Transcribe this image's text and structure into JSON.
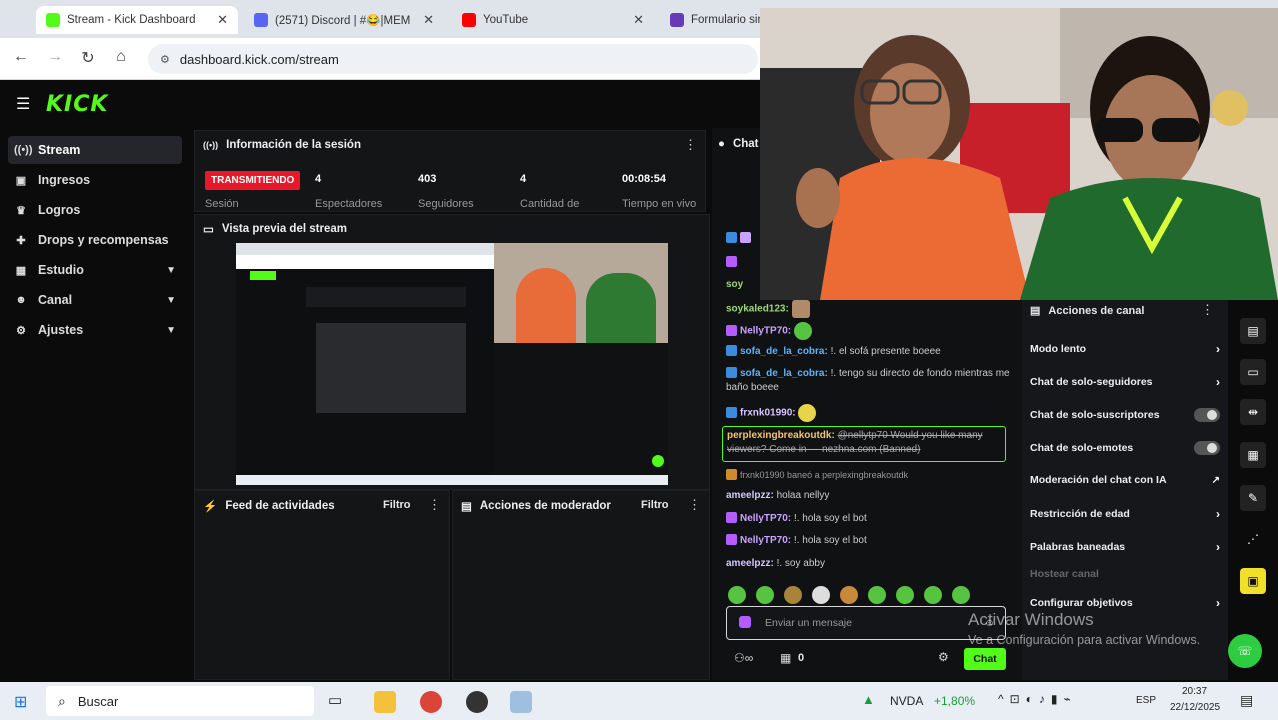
{
  "browser": {
    "tabs": [
      {
        "title": "Stream - Kick Dashboard",
        "active": true,
        "close": "✕"
      },
      {
        "title": "(2571) Discord | #😂|MEM",
        "active": false,
        "close": "✕"
      },
      {
        "title": "YouTube",
        "active": false,
        "close": "✕"
      },
      {
        "title": "Formulario sin",
        "active": false,
        "close": ""
      }
    ],
    "url": "dashboard.kick.com/stream"
  },
  "kick": {
    "logo": "KICK"
  },
  "sidebar": {
    "items": [
      {
        "label": "Stream",
        "icon": "broadcast-icon"
      },
      {
        "label": "Ingresos",
        "icon": "wallet-icon"
      },
      {
        "label": "Logros",
        "icon": "trophy-icon"
      },
      {
        "label": "Drops y recompensas",
        "icon": "gift-icon"
      },
      {
        "label": "Estudio",
        "icon": "grid-icon"
      },
      {
        "label": "Canal",
        "icon": "people-icon"
      },
      {
        "label": "Ajustes",
        "icon": "gear-icon"
      }
    ]
  },
  "session": {
    "title": "Información de la sesión",
    "live": "TRANSMITIENDO",
    "live_sub": "Sesión",
    "stats": [
      {
        "value": "4",
        "label": "Espectadores"
      },
      {
        "value": "403",
        "label": "Seguidores"
      },
      {
        "value": "4",
        "label": "Cantidad de"
      },
      {
        "value": "00:08:54",
        "label": "Tiempo en vivo"
      }
    ]
  },
  "preview": {
    "title": "Vista previa del stream"
  },
  "feed": {
    "title": "Feed de actividades",
    "filter": "Filtro"
  },
  "modlog": {
    "title": "Acciones de moderador",
    "filter": "Filtro"
  },
  "chat": {
    "title": "Chat",
    "messages": [
      {
        "user": "soykaled123:",
        "text": ""
      },
      {
        "user": "NellyTP70:",
        "text": ""
      },
      {
        "user": "sofa_de_la_cobra:",
        "text": "!. el sofá presente boeee"
      },
      {
        "user": "sofa_de_la_cobra:",
        "text": "!. tengo su directo de fondo mientras me baño boeee"
      },
      {
        "user": "frxnk01990:",
        "text": ""
      },
      {
        "user": "perplexingbreakoutdk:",
        "text": "@nellytp70 Would you like many viewers? Come in — nezhna.com (Banned)"
      },
      {
        "user": "frxnk01990",
        "text": "baneó a perplexingbreakoutdk"
      },
      {
        "user": "ameelpzz:",
        "text": "holaa nellyy"
      },
      {
        "user": "NellyTP70:",
        "text": "!. hola soy el bot"
      },
      {
        "user": "NellyTP70:",
        "text": "!. hola soy el bot"
      },
      {
        "user": "ameelpzz:",
        "text": "!. soy abby"
      }
    ],
    "placeholder": "Enviar un mensaje",
    "count": "0",
    "send": "Chat"
  },
  "mod_actions": {
    "title": "Acciones de canal",
    "rows": [
      {
        "label": "Modo lento",
        "kind": "chevron"
      },
      {
        "label": "Chat de solo-seguidores",
        "kind": "chevron"
      },
      {
        "label": "Chat de solo-suscriptores",
        "kind": "toggle"
      },
      {
        "label": "Chat de solo-emotes",
        "kind": "toggle"
      },
      {
        "label": "Moderación del chat con IA",
        "kind": "external"
      },
      {
        "label": "Restricción de edad",
        "kind": "chevron"
      },
      {
        "label": "Palabras baneadas",
        "kind": "chevron"
      },
      {
        "label": "Hostear canal",
        "kind": "none"
      },
      {
        "label": "Configurar objetivos",
        "kind": "chevron"
      }
    ]
  },
  "watermark": {
    "line1": "Activar Windows",
    "line2": "Ve a Configuración para activar Windows."
  },
  "taskbar": {
    "search": "Buscar",
    "stock_name": "NVDA",
    "stock_change": "+1,80%",
    "lang": "ESP",
    "time": "20:37",
    "date": "22/12/2025"
  },
  "colors": {
    "accent": "#53fc18",
    "live": "#e8182a"
  }
}
